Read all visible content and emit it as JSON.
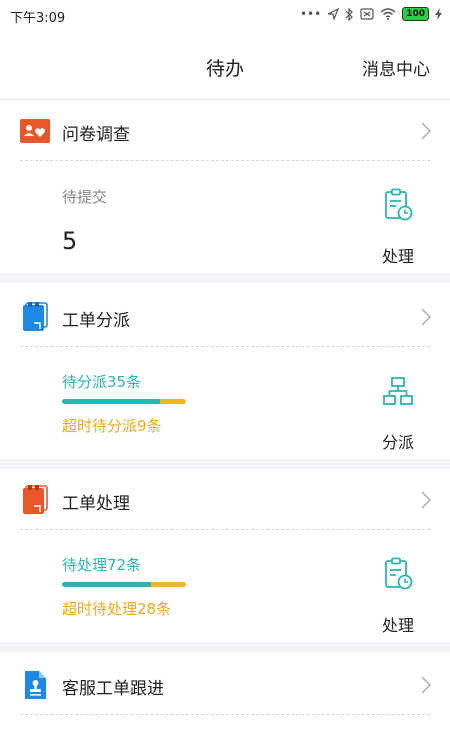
{
  "status_bar": {
    "time": "下午3:09",
    "battery": "100",
    "icons": [
      "dots-icon",
      "location-icon",
      "bluetooth-icon",
      "sim-icon",
      "wifi-icon",
      "battery-icon",
      "charging-icon"
    ]
  },
  "header": {
    "title": "待办",
    "message_center": "消息中心"
  },
  "colors": {
    "teal": "#2bb5b5",
    "orange": "#f0a81c",
    "survey_icon": "#e8562a",
    "dispatch_icon": "#1e88e5",
    "process_icon": "#e8562a",
    "follow_icon": "#1e88e5"
  },
  "cards": {
    "survey": {
      "title": "问卷调查",
      "pending_label": "待提交",
      "pending_count": "5",
      "action": "处理"
    },
    "dispatch": {
      "title": "工单分派",
      "line1": "待分派35条",
      "line2": "超时待分派9条",
      "progress": 0.79,
      "action": "分派"
    },
    "process": {
      "title": "工单处理",
      "line1": "待处理72条",
      "line2": "超时待处理28条",
      "progress": 0.72,
      "action": "处理"
    },
    "follow": {
      "title": "客服工单跟进"
    }
  }
}
